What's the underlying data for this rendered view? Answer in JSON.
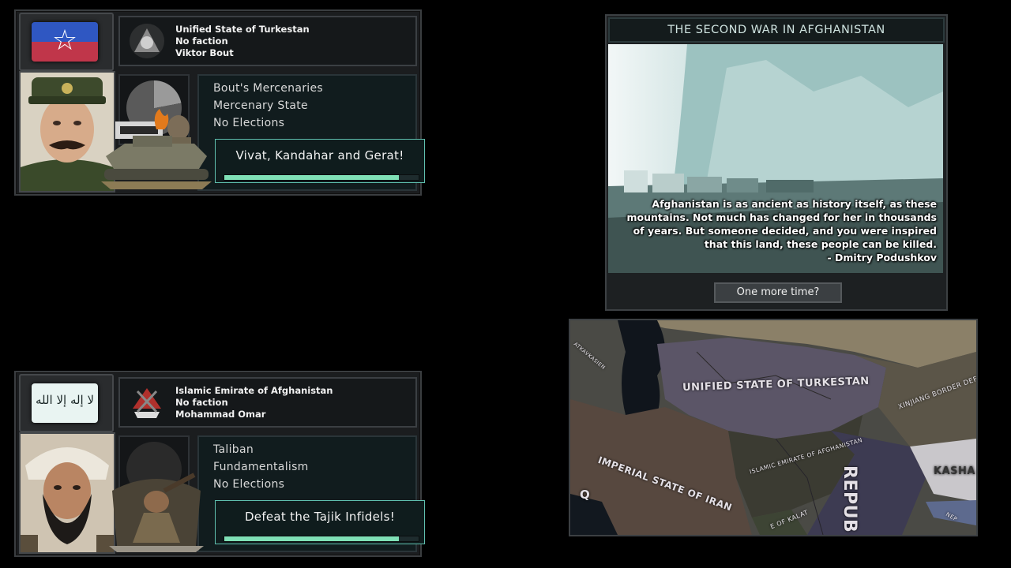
{
  "panels": [
    {
      "flag": "turkestan-flag",
      "country": "Unified State of Turkestan",
      "faction": "No faction",
      "leader": "Viktor Bout",
      "party": "Bout's Mercenaries",
      "ideology": "Mercenary State",
      "elections": "No Elections",
      "slogan": "Vivat, Kandahar and Gerat!",
      "progress": 0.9
    },
    {
      "flag": "islamic-emirate-flag",
      "country": "Islamic Emirate of Afghanistan",
      "faction": "No faction",
      "leader": "Mohammad Omar",
      "party": "Taliban",
      "ideology": "Fundamentalism",
      "elections": "No Elections",
      "slogan": "Defeat the Tajik Infidels!",
      "progress": 0.9
    }
  ],
  "event": {
    "title": "THE SECOND WAR IN AFGHANISTAN",
    "quote_lines": [
      "Afghanistan is as ancient as history itself, as these",
      "mountains. Not much has changed for her in thousands",
      "of years. But someone decided, and you were inspired",
      "that this land, these people can be killed."
    ],
    "quote_author": "- Dmitry Podushkov",
    "button": "One more time?"
  },
  "map": {
    "labels": {
      "turkestan": "UNIFIED STATE OF TURKESTAN",
      "iran": "IMPERIAL STATE OF IRAN",
      "afghanistan": "ISLAMIC EMIRATE OF AFGHANISTAN",
      "xinjiang": "XINJIANG BORDER DEFE",
      "kasha": "KASHA",
      "kalat": "E OF KALAT",
      "repub": "REPUB",
      "kavkasien": "ATKAVKASIEN",
      "nep": "NEP",
      "q": "Q"
    }
  },
  "colors": {
    "accent_green": "#7fe0b6",
    "slogan_border": "#5fbfae",
    "turkestan_map": "#5b5567",
    "afghanistan_map": "#3b3b32",
    "iran_map": "#57483f"
  }
}
